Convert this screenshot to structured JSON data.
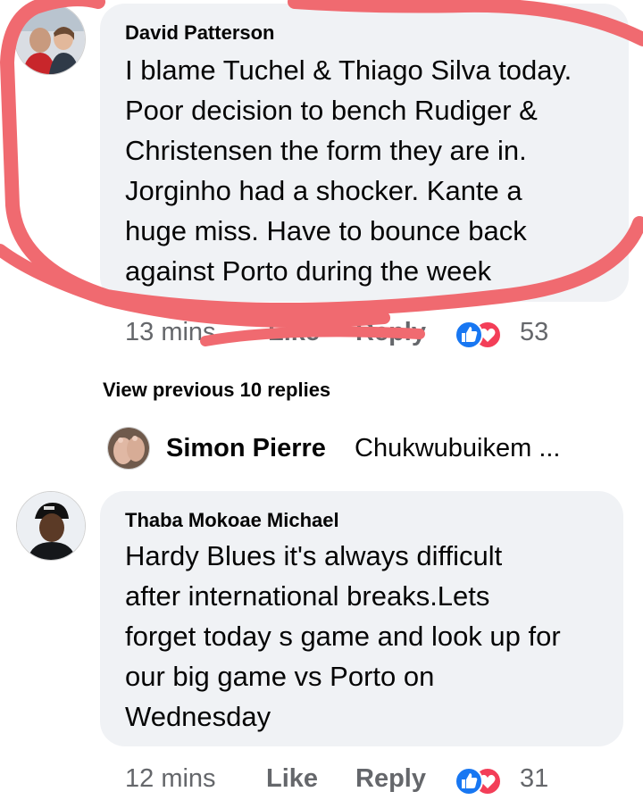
{
  "comment1": {
    "author": "David Patterson",
    "lines": [
      "I blame Tuchel & Thiago Silva today.",
      "Poor decision to bench Rudiger &",
      "Christensen the form they are in.",
      "Jorginho had a shocker. Kante a",
      "huge miss. Have to bounce back",
      "against Porto during the week"
    ],
    "time": "13 mins",
    "like_label": "Like",
    "reply_label": "Reply",
    "reaction_count": "53",
    "reaction_icons": [
      "like-icon",
      "love-icon"
    ]
  },
  "view_previous": "View previous 10 replies",
  "reply_preview": {
    "author": "Simon Pierre",
    "text": "Chukwubuikem ..."
  },
  "comment2": {
    "author": "Thaba Mokoae Michael",
    "lines": [
      "Hardy Blues it's always difficult",
      "after international breaks.Lets",
      "forget today s game and look up for",
      "our big game vs Porto on",
      "Wednesday"
    ],
    "time": "12 mins",
    "like_label": "Like",
    "reply_label": "Reply",
    "reaction_count": "31",
    "reaction_icons": [
      "like-icon",
      "love-icon"
    ]
  },
  "colors": {
    "bubble": "#f0f2f5",
    "meta_text": "#65676b",
    "like_blue": "#1877f2",
    "love_red": "#f33e58",
    "scribble": "#f06a70"
  }
}
